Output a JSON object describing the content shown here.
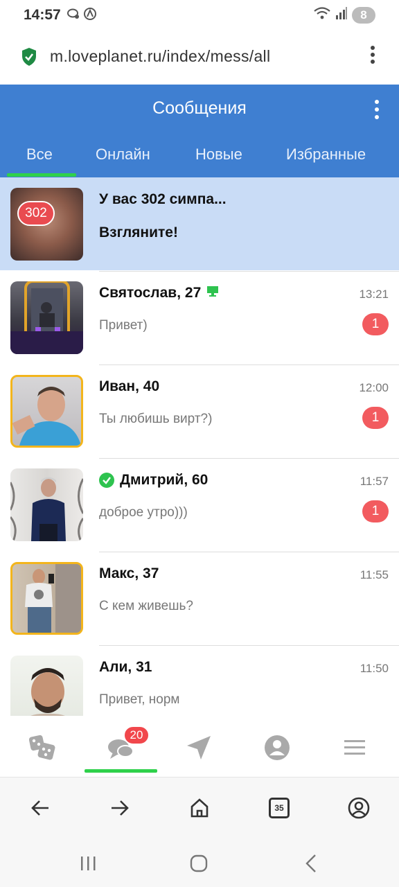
{
  "status_bar": {
    "time": "14:57",
    "battery": "8"
  },
  "browser": {
    "url": "m.loveplanet.ru/index/mess/all",
    "tab_count": "35"
  },
  "header": {
    "title": "Сообщения",
    "tabs": [
      {
        "label": "Все"
      },
      {
        "label": "Онлайн"
      },
      {
        "label": "Новые"
      },
      {
        "label": "Избранные"
      }
    ]
  },
  "promo": {
    "badge": "302",
    "title": "У вас 302 симпа...",
    "subtitle": "Взгляните!"
  },
  "conversations": [
    {
      "name": "Святослав, 27",
      "time": "13:21",
      "preview": "Привет)",
      "unread": "1",
      "online_icon": "desktop-icon"
    },
    {
      "name": "Иван, 40",
      "time": "12:00",
      "preview": "Ты любишь вирт?)",
      "unread": "1"
    },
    {
      "name": "Дмитрий, 60",
      "time": "11:57",
      "preview": "доброе утро)))",
      "unread": "1",
      "verified": true
    },
    {
      "name": "Макс, 37",
      "time": "11:55",
      "preview": "С кем живешь?"
    },
    {
      "name": "Али, 31",
      "time": "11:50",
      "preview": "Привет, норм"
    }
  ],
  "bottom_nav": {
    "messages_badge": "20",
    "items": [
      "dice-icon",
      "chat-icon",
      "send-icon",
      "profile-icon",
      "menu-icon"
    ]
  },
  "colors": {
    "header": "#3f7fd1",
    "promo_bg": "#c9dcf6",
    "accent_green": "#2fd14b",
    "badge_red": "#f25b5f",
    "avatar_border": "#f3b51c"
  }
}
